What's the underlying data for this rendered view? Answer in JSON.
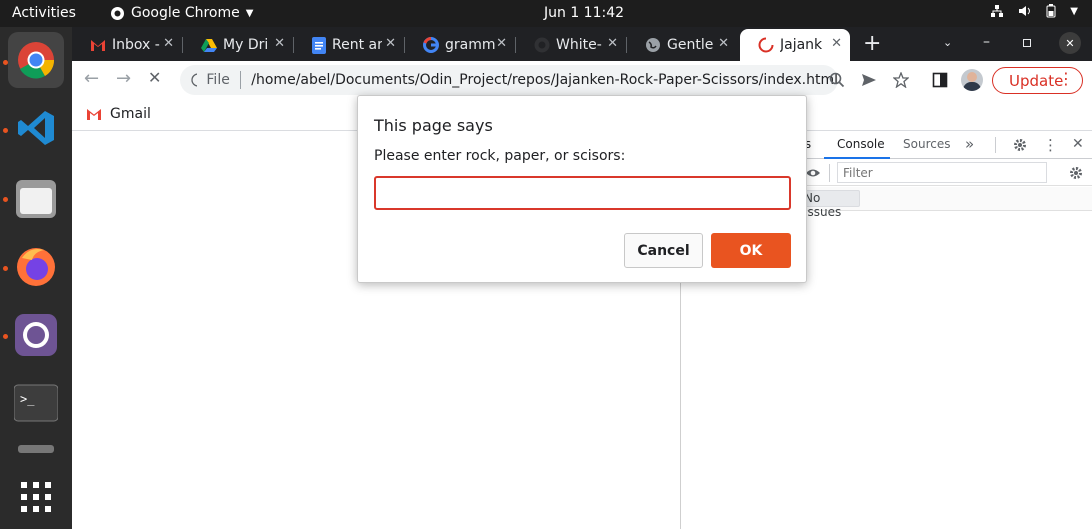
{
  "topbar": {
    "activities": "Activities",
    "app_name": "Google Chrome",
    "clock": "Jun 1  11:42"
  },
  "tabs": [
    {
      "title": "Inbox -",
      "icon": "gmail-icon"
    },
    {
      "title": "My Dri",
      "icon": "drive-icon"
    },
    {
      "title": "Rent ar",
      "icon": "docs-icon"
    },
    {
      "title": "gramm",
      "icon": "google-icon"
    },
    {
      "title": "White-",
      "icon": "github-icon"
    },
    {
      "title": "Gentle",
      "icon": "globe-icon"
    },
    {
      "title": "Jajank",
      "icon": "loading-icon",
      "active": true
    }
  ],
  "toolbar": {
    "scheme_label": "File",
    "url": "/home/abel/Documents/Odin_Project/repos/Jajanken-Rock-Paper-Scissors/index.html",
    "update_label": "Update"
  },
  "bookmarks": {
    "gmail": "Gmail"
  },
  "devtools": {
    "tab_console": "Console",
    "tab_sources": "Sources",
    "filter_placeholder": "Filter",
    "issues": "No Issues",
    "cut_tab": "rs"
  },
  "dialog": {
    "title": "This page says",
    "message": "Please enter rock, paper, or scisors:",
    "input_value": "",
    "cancel_label": "Cancel",
    "ok_label": "OK"
  },
  "colors": {
    "accent": "#e95420",
    "chrome_dark": "#202124",
    "link_blue": "#1a73e8"
  }
}
